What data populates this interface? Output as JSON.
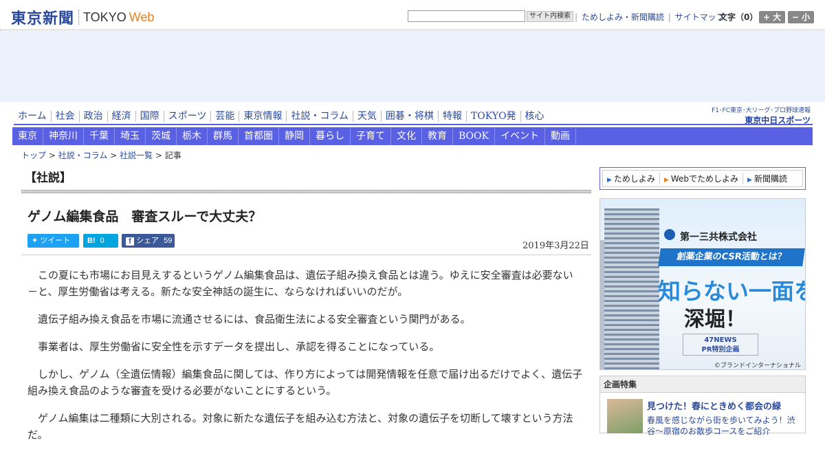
{
  "header": {
    "logo_jp": "東京新聞",
    "logo_en": "TOKYO",
    "logo_web": "Web",
    "search_placeholder": "",
    "search_button": "サイト内検索",
    "util_links": [
      "ためしよみ・新聞購読",
      "サイトマップ"
    ],
    "font_size_label": "文字（0）",
    "font_larger": "+ 大",
    "font_smaller": "− 小"
  },
  "main_nav": [
    "ホーム",
    "社会",
    "政治",
    "経済",
    "国際",
    "スポーツ",
    "芸能",
    "東京情報",
    "社説・コラム",
    "天気",
    "囲碁・将棋",
    "特報",
    "TOKYO発",
    "核心"
  ],
  "chunichi": {
    "line1": "F1･FC東京･大リーグ･プロ野球速報",
    "line2": "東京中日スポーツ"
  },
  "sub_nav": [
    "東京",
    "神奈川",
    "千葉",
    "埼玉",
    "茨城",
    "栃木",
    "群馬",
    "首都圏",
    "静岡",
    "暮らし",
    "子育て",
    "文化",
    "教育",
    "BOOK",
    "イベント",
    "動画"
  ],
  "breadcrumb": {
    "items": [
      "トップ",
      "社説・コラム",
      "社説一覧"
    ],
    "current": "記事"
  },
  "article": {
    "section": "【社説】",
    "headline": "ゲノム編集食品　審査スルーで大丈夫？",
    "share": {
      "tweet": "ツイート",
      "hatena": "B!",
      "hatena_count": "0",
      "facebook": "シェア",
      "facebook_count": "59"
    },
    "date": "2019年3月22日",
    "paragraphs": [
      "この夏にも市場にお目見えするというゲノム編集食品は、遺伝子組み換え食品とは違う。ゆえに安全審査は必要ない－と、厚生労働省は考える。新たな安全神話の誕生に、ならなければいいのだが。",
      "遺伝子組み換え食品を市場に流通させるには、食品衛生法による安全審査という関門がある。",
      "事業者は、厚生労働省に安全性を示すデータを提出し、承認を得ることになっている。",
      "しかし、ゲノム（全遺伝情報）編集食品に関しては、作り方によっては開発情報を任意で届け出るだけでよく、遺伝子組み換え食品のような審査を受ける必要がないことにするという。",
      "ゲノム編集は二種類に大別される。対象に新たな遺伝子を組み込む方法と、対象の遺伝子を切断して壊すという方法だ。"
    ]
  },
  "sidebar": {
    "links": [
      "ためしよみ",
      "Webでためしよみ",
      "新聞購読"
    ],
    "ad": {
      "company": "第一三共株式会社",
      "banner": "創薬企業のCSR活動とは？",
      "big1": "知らない一面を",
      "big2": "深堀！",
      "news1": "47NEWS",
      "news2": "PR特別企画",
      "credit": "©ブランドインターナショナル"
    },
    "feature": {
      "heading": "企画特集",
      "title": "見つけた！春にときめく都会の緑",
      "desc": "春風を感じながら街を歩いてみよう！渋谷～原宿のお散歩コースをご紹介"
    }
  },
  "colors": {
    "brand_blue": "#2a4a9c",
    "nav_purple": "#5960e4",
    "web_orange": "#e8821e"
  }
}
